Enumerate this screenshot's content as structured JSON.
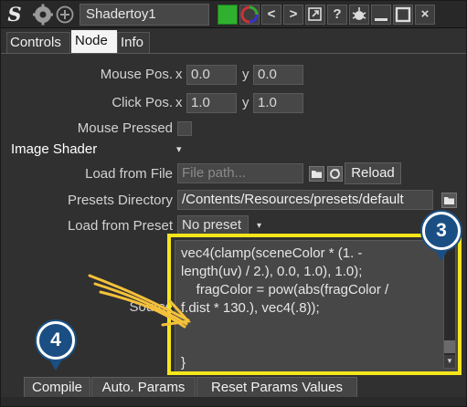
{
  "window": {
    "app_icon": "S",
    "title": "Shadertoy1",
    "title_icons": [
      "gear-icon",
      "plus-circle-icon"
    ],
    "title_buttons": [
      "green-square-icon",
      "color-wheel-icon",
      "arrow-left-icon",
      "arrow-right-icon",
      "duplicate-icon",
      "help-icon",
      "settings-bug-icon",
      "minimize-icon",
      "maximize-icon",
      "close-icon"
    ],
    "labels": {
      "prev": "<",
      "next": ">",
      "help": "?",
      "close": "×"
    },
    "accent_green": "#2fb12f"
  },
  "tabs": [
    "Controls",
    "Node",
    "Info"
  ],
  "active_tab": "Node",
  "params": {
    "mouse_pos": {
      "label": "Mouse Pos.",
      "x_label": "x",
      "x_value": "0.0",
      "y_label": "y",
      "y_value": "0.0"
    },
    "click_pos": {
      "label": "Click Pos.",
      "x_label": "x",
      "x_value": "1.0",
      "y_label": "y",
      "y_value": "1.0"
    },
    "mouse_pressed": {
      "label": "Mouse Pressed",
      "checked": false
    },
    "image_shader": {
      "label": "Image Shader",
      "expand_icon": "▾"
    },
    "load_from_file": {
      "label": "Load from File",
      "placeholder": "File path...",
      "reload_label": "Reload"
    },
    "presets_directory": {
      "label": "Presets Directory",
      "value": "/Contents/Resources/presets/default"
    },
    "load_from_preset": {
      "label": "Load from Preset",
      "value": "No preset",
      "arrow": "▾"
    },
    "source": {
      "label": "Source",
      "text": "vec4(clamp(sceneColor * (1. -\nlength(uv) / 2.), 0.0, 1.0), 1.0);\n    fragColor = pow(abs(fragColor /\nf.dist * 130.), vec4(.8));\n\n\n}"
    }
  },
  "buttons": {
    "compile": "Compile",
    "auto_params": "Auto. Params",
    "reset_params": "Reset Params Values"
  },
  "annotations": {
    "badge_3": "3",
    "badge_4": "4",
    "highlight_color": "#f5e61b",
    "badge_color": "#1b4f83",
    "arrow_color": "#f5c13a"
  }
}
